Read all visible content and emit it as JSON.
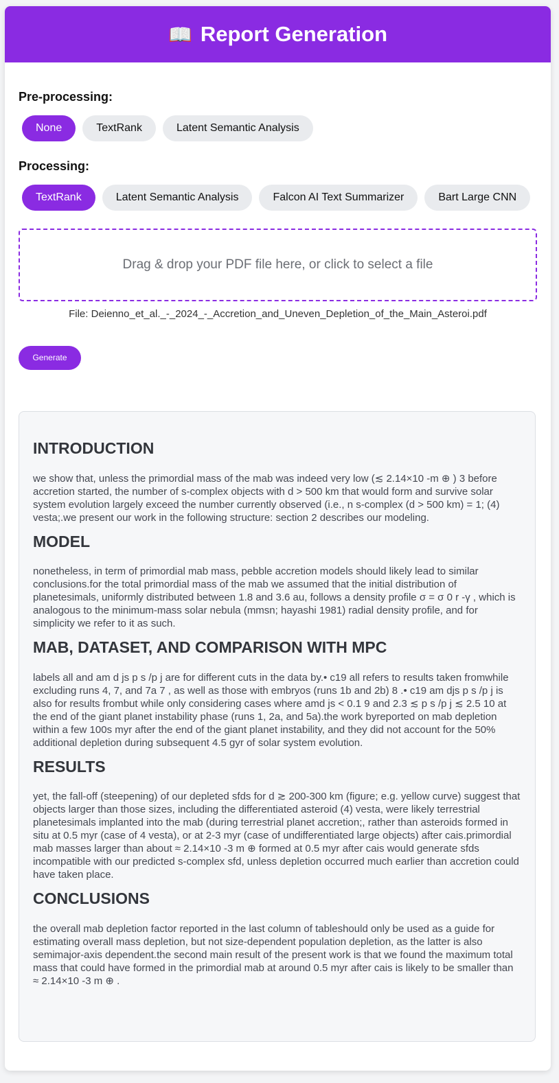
{
  "header": {
    "icon": "book-icon",
    "title": "Report Generation"
  },
  "preprocessing": {
    "label": "Pre-processing:",
    "options": [
      "None",
      "TextRank",
      "Latent Semantic Analysis"
    ],
    "selected": "None"
  },
  "processing": {
    "label": "Processing:",
    "options": [
      "TextRank",
      "Latent Semantic Analysis",
      "Falcon AI Text Summarizer",
      "Bart Large CNN"
    ],
    "selected": "TextRank"
  },
  "upload": {
    "dropzone_text": "Drag & drop your PDF file here, or click to select a file",
    "file_label": "File: Deienno_et_al._-_2024_-_Accretion_and_Uneven_Depletion_of_the_Main_Asteroi.pdf"
  },
  "generate_label": "Generate",
  "report": {
    "sections": [
      {
        "heading": "INTRODUCTION",
        "body": "we show that, unless the primordial mass of the mab was indeed very low (≲ 2.14×10 -m ⊕ ) 3 before accretion started, the number of s-complex objects with d > 500 km that would form and survive solar system evolution largely exceed the number currently observed (i.e., n s-complex (d > 500 km) = 1; (4) vesta;.we present our work in the following structure: section 2 describes our modeling."
      },
      {
        "heading": "MODEL",
        "body": "nonetheless, in term of primordial mab mass, pebble accretion models should likely lead to similar conclusions.for the total primordial mass of the mab we assumed that the initial distribution of planetesimals, uniformly distributed between 1.8 and 3.6 au, follows a density profile σ = σ 0 r -γ , which is analogous to the minimum-mass solar nebula (mmsn; hayashi 1981) radial density profile, and for simplicity we refer to it as such."
      },
      {
        "heading": "MAB, DATASET, AND COMPARISON WITH MPC",
        "body": "labels all and am d js p s /p j are for different cuts in the data by.• c19 all refers to results taken fromwhile excluding runs 4, 7, and 7a 7 , as well as those with embryos (runs 1b and 2b) 8 .• c19 am djs p s /p j is also for results frombut while only considering cases where amd js < 0.1 9 and 2.3 ≲ p s /p j ≲ 2.5 10 at the end of the giant planet instability phase (runs 1, 2a, and 5a).the work byreported on mab depletion within a few 100s myr after the end of the giant planet instability, and they did not account for the 50% additional depletion during subsequent 4.5 gyr of solar system evolution."
      },
      {
        "heading": "RESULTS",
        "body": "yet, the fall-off (steepening) of our depleted sfds for d ≳ 200-300 km (figure; e.g. yellow curve) suggest that objects larger than those sizes, including the differentiated asteroid (4) vesta, were likely terrestrial planetesimals implanted into the mab (during terrestrial planet accretion;, rather than asteroids formed in situ at 0.5 myr (case of 4 vesta), or at 2-3 myr (case of undifferentiated large objects) after cais.primordial mab masses larger than about ≈ 2.14×10 -3 m ⊕ formed at 0.5 myr after cais would generate sfds incompatible with our predicted s-complex sfd, unless depletion occurred much earlier than accretion could have taken place."
      },
      {
        "heading": "CONCLUSIONS",
        "body": "the overall mab depletion factor reported in the last column of tableshould only be used as a guide for estimating overall mass depletion, but not size-dependent population depletion, as the latter is also semimajor-axis dependent.the second main result of the present work is that we found the maximum total mass that could have formed in the primordial mab at around 0.5 myr after cais is likely to be smaller than ≈ 2.14×10 -3 m ⊕ ."
      }
    ]
  },
  "colors": {
    "accent": "#8a2be2",
    "pill_bg": "#e9ebee",
    "report_bg": "#f6f7f9"
  }
}
